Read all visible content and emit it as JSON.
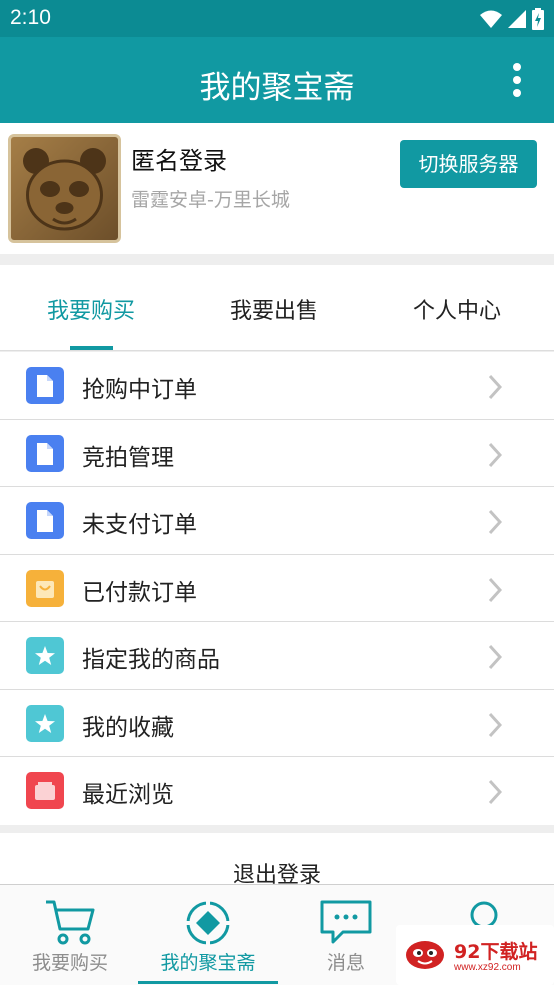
{
  "status_bar": {
    "time": "2:10"
  },
  "app_bar": {
    "title": "我的聚宝斋"
  },
  "profile": {
    "name": "匿名登录",
    "server": "雷霆安卓-万里长城",
    "switch_label": "切换服务器"
  },
  "tabs": [
    {
      "label": "我要购买",
      "active": true
    },
    {
      "label": "我要出售",
      "active": false
    },
    {
      "label": "个人中心",
      "active": false
    }
  ],
  "menu": [
    {
      "label": "抢购中订单",
      "icon": "document-icon",
      "color": "#4a80f0"
    },
    {
      "label": "竞拍管理",
      "icon": "document-icon",
      "color": "#4a80f0"
    },
    {
      "label": "未支付订单",
      "icon": "document-icon",
      "color": "#4a80f0"
    },
    {
      "label": "已付款订单",
      "icon": "bag-icon",
      "color": "#f6b13a"
    },
    {
      "label": "指定我的商品",
      "icon": "star-icon",
      "color": "#4fc7d4"
    },
    {
      "label": "我的收藏",
      "icon": "star-icon",
      "color": "#4fc7d4"
    },
    {
      "label": "最近浏览",
      "icon": "card-icon",
      "color": "#f0464f"
    }
  ],
  "logout_label": "退出登录",
  "bottom_nav": [
    {
      "label": "我要购买",
      "icon": "cart-icon",
      "active": false
    },
    {
      "label": "我的聚宝斋",
      "icon": "treasure-icon",
      "active": true
    },
    {
      "label": "消息",
      "icon": "message-icon",
      "active": false
    },
    {
      "label": "",
      "icon": "profile-icon",
      "active": false
    }
  ],
  "watermark": {
    "title": "92下载站",
    "url": "www.xz92.com"
  },
  "colors": {
    "accent": "#1199a2",
    "status_bar": "#0c8b93"
  }
}
